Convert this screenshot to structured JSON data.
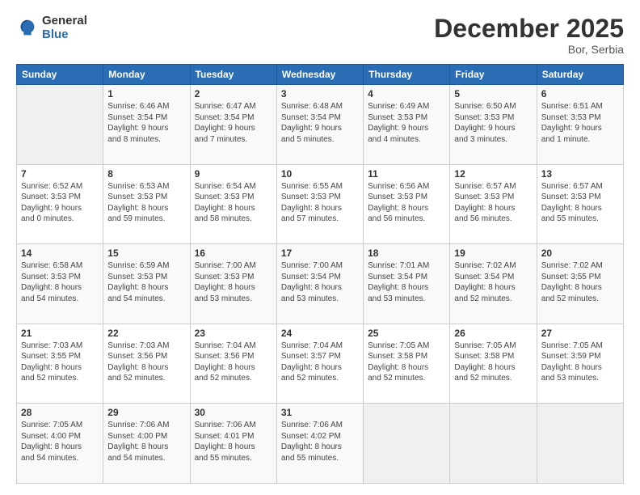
{
  "header": {
    "logo_general": "General",
    "logo_blue": "Blue",
    "month": "December 2025",
    "location": "Bor, Serbia"
  },
  "weekdays": [
    "Sunday",
    "Monday",
    "Tuesday",
    "Wednesday",
    "Thursday",
    "Friday",
    "Saturday"
  ],
  "weeks": [
    [
      {
        "day": "",
        "info": ""
      },
      {
        "day": "1",
        "info": "Sunrise: 6:46 AM\nSunset: 3:54 PM\nDaylight: 9 hours\nand 8 minutes."
      },
      {
        "day": "2",
        "info": "Sunrise: 6:47 AM\nSunset: 3:54 PM\nDaylight: 9 hours\nand 7 minutes."
      },
      {
        "day": "3",
        "info": "Sunrise: 6:48 AM\nSunset: 3:54 PM\nDaylight: 9 hours\nand 5 minutes."
      },
      {
        "day": "4",
        "info": "Sunrise: 6:49 AM\nSunset: 3:53 PM\nDaylight: 9 hours\nand 4 minutes."
      },
      {
        "day": "5",
        "info": "Sunrise: 6:50 AM\nSunset: 3:53 PM\nDaylight: 9 hours\nand 3 minutes."
      },
      {
        "day": "6",
        "info": "Sunrise: 6:51 AM\nSunset: 3:53 PM\nDaylight: 9 hours\nand 1 minute."
      }
    ],
    [
      {
        "day": "7",
        "info": "Sunrise: 6:52 AM\nSunset: 3:53 PM\nDaylight: 9 hours\nand 0 minutes."
      },
      {
        "day": "8",
        "info": "Sunrise: 6:53 AM\nSunset: 3:53 PM\nDaylight: 8 hours\nand 59 minutes."
      },
      {
        "day": "9",
        "info": "Sunrise: 6:54 AM\nSunset: 3:53 PM\nDaylight: 8 hours\nand 58 minutes."
      },
      {
        "day": "10",
        "info": "Sunrise: 6:55 AM\nSunset: 3:53 PM\nDaylight: 8 hours\nand 57 minutes."
      },
      {
        "day": "11",
        "info": "Sunrise: 6:56 AM\nSunset: 3:53 PM\nDaylight: 8 hours\nand 56 minutes."
      },
      {
        "day": "12",
        "info": "Sunrise: 6:57 AM\nSunset: 3:53 PM\nDaylight: 8 hours\nand 56 minutes."
      },
      {
        "day": "13",
        "info": "Sunrise: 6:57 AM\nSunset: 3:53 PM\nDaylight: 8 hours\nand 55 minutes."
      }
    ],
    [
      {
        "day": "14",
        "info": "Sunrise: 6:58 AM\nSunset: 3:53 PM\nDaylight: 8 hours\nand 54 minutes."
      },
      {
        "day": "15",
        "info": "Sunrise: 6:59 AM\nSunset: 3:53 PM\nDaylight: 8 hours\nand 54 minutes."
      },
      {
        "day": "16",
        "info": "Sunrise: 7:00 AM\nSunset: 3:53 PM\nDaylight: 8 hours\nand 53 minutes."
      },
      {
        "day": "17",
        "info": "Sunrise: 7:00 AM\nSunset: 3:54 PM\nDaylight: 8 hours\nand 53 minutes."
      },
      {
        "day": "18",
        "info": "Sunrise: 7:01 AM\nSunset: 3:54 PM\nDaylight: 8 hours\nand 53 minutes."
      },
      {
        "day": "19",
        "info": "Sunrise: 7:02 AM\nSunset: 3:54 PM\nDaylight: 8 hours\nand 52 minutes."
      },
      {
        "day": "20",
        "info": "Sunrise: 7:02 AM\nSunset: 3:55 PM\nDaylight: 8 hours\nand 52 minutes."
      }
    ],
    [
      {
        "day": "21",
        "info": "Sunrise: 7:03 AM\nSunset: 3:55 PM\nDaylight: 8 hours\nand 52 minutes."
      },
      {
        "day": "22",
        "info": "Sunrise: 7:03 AM\nSunset: 3:56 PM\nDaylight: 8 hours\nand 52 minutes."
      },
      {
        "day": "23",
        "info": "Sunrise: 7:04 AM\nSunset: 3:56 PM\nDaylight: 8 hours\nand 52 minutes."
      },
      {
        "day": "24",
        "info": "Sunrise: 7:04 AM\nSunset: 3:57 PM\nDaylight: 8 hours\nand 52 minutes."
      },
      {
        "day": "25",
        "info": "Sunrise: 7:05 AM\nSunset: 3:58 PM\nDaylight: 8 hours\nand 52 minutes."
      },
      {
        "day": "26",
        "info": "Sunrise: 7:05 AM\nSunset: 3:58 PM\nDaylight: 8 hours\nand 52 minutes."
      },
      {
        "day": "27",
        "info": "Sunrise: 7:05 AM\nSunset: 3:59 PM\nDaylight: 8 hours\nand 53 minutes."
      }
    ],
    [
      {
        "day": "28",
        "info": "Sunrise: 7:05 AM\nSunset: 4:00 PM\nDaylight: 8 hours\nand 54 minutes."
      },
      {
        "day": "29",
        "info": "Sunrise: 7:06 AM\nSunset: 4:00 PM\nDaylight: 8 hours\nand 54 minutes."
      },
      {
        "day": "30",
        "info": "Sunrise: 7:06 AM\nSunset: 4:01 PM\nDaylight: 8 hours\nand 55 minutes."
      },
      {
        "day": "31",
        "info": "Sunrise: 7:06 AM\nSunset: 4:02 PM\nDaylight: 8 hours\nand 55 minutes."
      },
      {
        "day": "",
        "info": ""
      },
      {
        "day": "",
        "info": ""
      },
      {
        "day": "",
        "info": ""
      }
    ]
  ]
}
